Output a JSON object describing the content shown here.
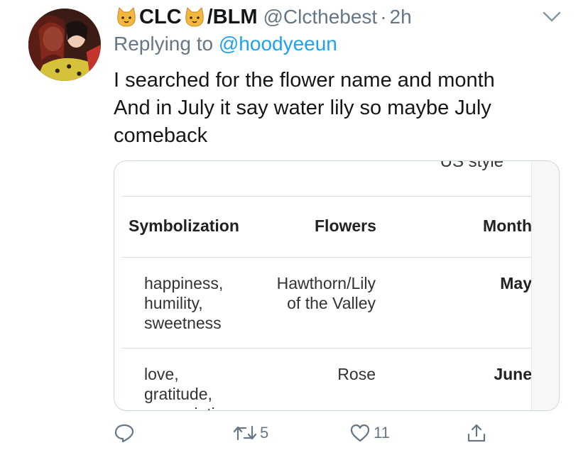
{
  "tweet": {
    "display_name_part1": "CLC",
    "display_name_part2": "/BLM",
    "handle": "@Clcthebest",
    "separator": "·",
    "time": "2h",
    "replying_prefix": "Replying to",
    "replying_to": "@hoodyeeun",
    "text_lines": [
      "I searched for the flower name and month",
      "And in July it say water lily so maybe July",
      "comeback"
    ]
  },
  "media": {
    "cut_title": "US style",
    "table": {
      "headers": [
        "Symbolization",
        "Flowers",
        "Month"
      ],
      "rows": [
        {
          "symbolization": [
            "happiness,",
            "humility,",
            "sweetness"
          ],
          "flowers": [
            "Hawthorn/Lily",
            "of the Valley"
          ],
          "month": "May"
        },
        {
          "symbolization": [
            "love,",
            "gratitude,",
            "appreciation"
          ],
          "flowers": [
            "Rose"
          ],
          "month": "June"
        }
      ]
    }
  },
  "actions": {
    "reply_count": "",
    "retweet_count": "5",
    "like_count": "11"
  },
  "colors": {
    "text": "#14171a",
    "secondary": "#657786",
    "link": "#1da1f2",
    "border": "#ccd6dd"
  },
  "icons": [
    "cat-emoji-icon",
    "chevron-down-icon",
    "reply-icon",
    "retweet-icon",
    "like-icon",
    "share-icon"
  ]
}
